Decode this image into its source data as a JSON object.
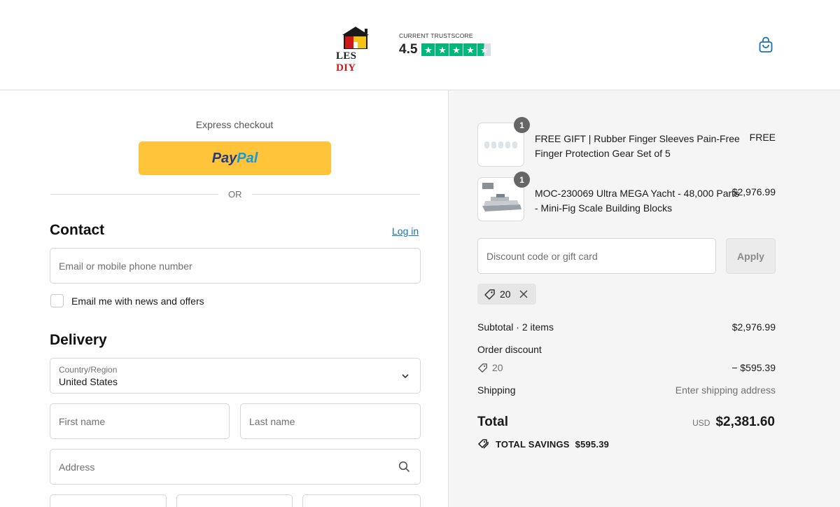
{
  "header": {
    "logo": {
      "text_les": "LES",
      "text_diy": "DIY"
    },
    "trustscore": {
      "label": "CURRENT TRUSTSCORE",
      "score": "4.5",
      "rating": 4.5,
      "max": 5
    },
    "cart_icon": "shopping-bag-icon"
  },
  "express": {
    "label": "Express checkout",
    "paypal_pay": "Pay",
    "paypal_pal": "Pal",
    "or": "OR"
  },
  "contact": {
    "title": "Contact",
    "login": "Log in",
    "email_placeholder": "Email or mobile phone number",
    "newsletter_label": "Email me with news and offers"
  },
  "delivery": {
    "title": "Delivery",
    "country_label": "Country/Region",
    "country_value": "United States",
    "first_name_placeholder": "First name",
    "last_name_placeholder": "Last name",
    "address_placeholder": "Address"
  },
  "order": {
    "items": [
      {
        "qty": "1",
        "name": "FREE GIFT | Rubber Finger Sleeves Pain-Free Finger Protection Gear Set of 5",
        "price": "FREE"
      },
      {
        "qty": "1",
        "name": "MOC-230069 Ultra MEGA Yacht - 48,000 Parts - Mini-Fig Scale Building Blocks",
        "price": "$2,976.99"
      }
    ],
    "discount_placeholder": "Discount code or gift card",
    "apply_label": "Apply",
    "applied_code": "20",
    "subtotal_label": "Subtotal · 2 items",
    "subtotal_value": "$2,976.99",
    "order_discount_label": "Order discount",
    "discount_code": "20",
    "discount_value": "− $595.39",
    "shipping_label": "Shipping",
    "shipping_value": "Enter shipping address",
    "total_label": "Total",
    "currency": "USD",
    "total_value": "$2,381.60",
    "savings_label": "TOTAL SAVINGS",
    "savings_value": "$595.39"
  },
  "colors": {
    "paypal_yellow": "#ffc439",
    "link_blue": "#1773b0",
    "trustpilot_green": "#00b67a",
    "summary_bg": "#f5f5f5"
  }
}
